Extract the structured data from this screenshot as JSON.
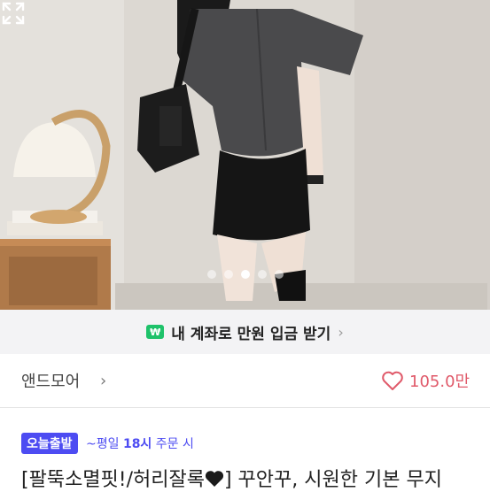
{
  "photo": {
    "alt_icon": "expand-icon",
    "carousel": {
      "count": 5,
      "active_index": 2
    }
  },
  "promo": {
    "icon_text": "₩",
    "text": "내 계좌로 만원 입금 받기",
    "arrow": "›"
  },
  "shop": {
    "name": "앤드모어",
    "arrow": "›",
    "likes": "105.0만"
  },
  "delivery": {
    "badge": "오늘출발",
    "prefix": "~평일 ",
    "time": "18시",
    "suffix": " 주문 시"
  },
  "product": {
    "title_before": "[팔뚝소멸핏!/허리잘록",
    "title_after": "] 꾸안꾸, 시원한 기본 무지"
  },
  "colors": {
    "accent": "#4d4cf2",
    "like": "#e05a6a",
    "promo_icon": "#1ec26a"
  }
}
